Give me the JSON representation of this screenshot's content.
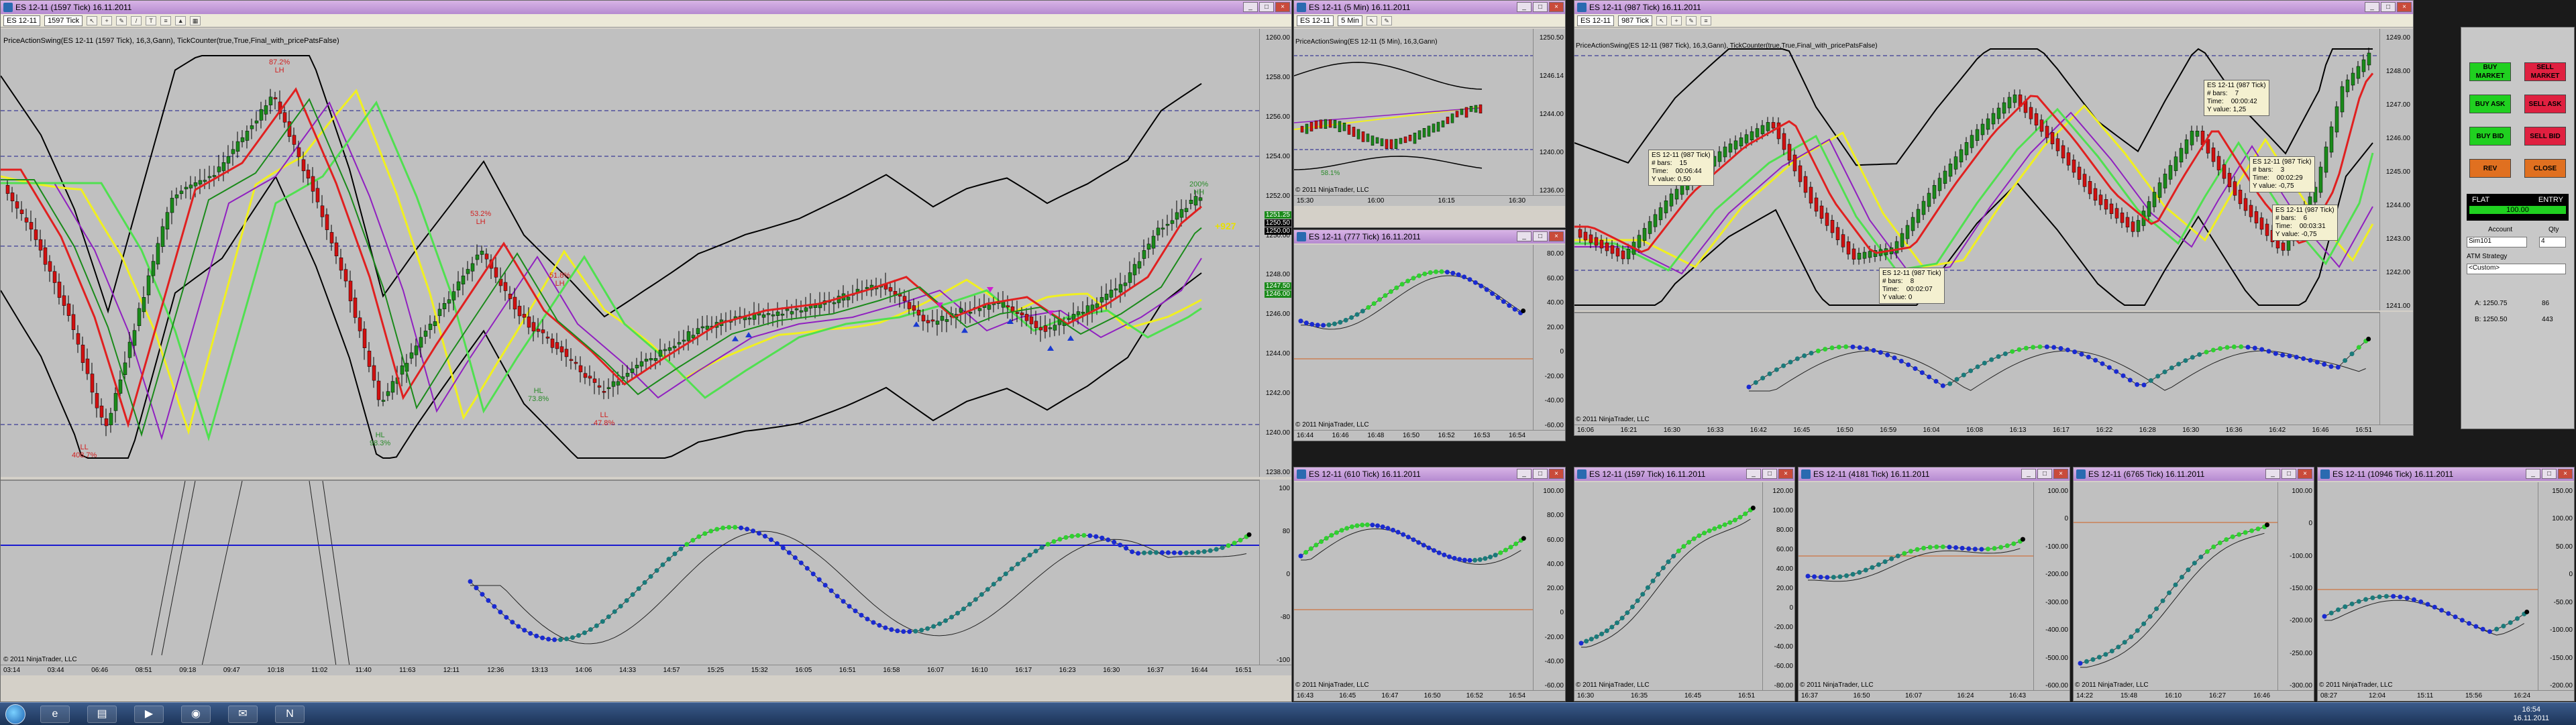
{
  "windows": {
    "main": {
      "title": "ES 12-11 (1597 Tick)  16.11.2011",
      "instrument": "ES 12-11",
      "interval": "1597 Tick",
      "indicator_label": "PriceActionSwing(ES 12-11 (1597 Tick), 16,3,Gann), TickCounter(true,True,Final_with_pricePatsFalse)",
      "copyright": "© 2011 NinjaTrader, LLC",
      "price_ticks": [
        "1260.00",
        "1258.00",
        "1256.00",
        "1254.00",
        "1252.00",
        "1250.00",
        "1248.00",
        "1246.00",
        "1244.00",
        "1242.00",
        "1240.00",
        "1238.00"
      ],
      "price_boxes": [
        "1251.25",
        "1250.50",
        "1250.00",
        "1247.50",
        "1246.00"
      ],
      "osc_ticks": [
        "100",
        "80",
        "0",
        "-80",
        "-100"
      ],
      "time_ticks": [
        "03:14",
        "03:44",
        "06:46",
        "08:51",
        "09:18",
        "09:47",
        "10:18",
        "11:02",
        "11:40",
        "11:63",
        "12:11",
        "12:36",
        "13:13",
        "14:06",
        "14:33",
        "14:57",
        "15:25",
        "15:32",
        "16:05",
        "16:51",
        "16:58",
        "16:07",
        "16:10",
        "16:17",
        "16:23",
        "16:30",
        "16:37",
        "16:44",
        "16:51"
      ],
      "annotations": [
        {
          "text": "87.2%\nLH",
          "color": "#d02020"
        },
        {
          "text": "LL\n408.7%",
          "color": "#d02020"
        },
        {
          "text": "HL\n98.3%",
          "color": "#2a8a2a"
        },
        {
          "text": "53.2%\nLH",
          "color": "#d02020"
        },
        {
          "text": "HL\n73.8%",
          "color": "#2a8a2a"
        },
        {
          "text": "51.8%\nLH",
          "color": "#d02020"
        },
        {
          "text": "LL\n47.8%",
          "color": "#d02020"
        },
        {
          "text": "200%\nHH",
          "color": "#2a8a2a"
        },
        {
          "text": "+927",
          "color": "#e8e000"
        }
      ]
    },
    "min5": {
      "title": "ES 12-11 (5 Min)  16.11.2011",
      "instrument": "ES 12-11",
      "interval": "5 Min",
      "indicator_label": "PriceActionSwing(ES 12-11 (5 Min), 16,3,Gann)",
      "copyright": "© 2011 NinjaTrader, LLC",
      "price_ticks": [
        "1250.50",
        "1246.14",
        "1244.00",
        "1240.00",
        "1236.00"
      ],
      "time_ticks": [
        "15:30",
        "16:00",
        "16:15",
        "16:30"
      ],
      "annotation": "58.1%"
    },
    "tick777": {
      "title": "ES 12-11 (777 Tick)  16.11.2011",
      "copyright": "© 2011 NinjaTrader, LLC",
      "ticks": [
        "80.00",
        "60.00",
        "40.00",
        "20.00",
        "0",
        "-20.00",
        "-40.00",
        "-60.00"
      ],
      "time_ticks": [
        "16:44",
        "16:46",
        "16:48",
        "16:50",
        "16:52",
        "16:53",
        "16:54"
      ]
    },
    "tick987": {
      "title": "ES 12-11 (987 Tick)  16.11.2011",
      "instrument": "ES 12-11",
      "interval": "987 Tick",
      "indicator_label": "PriceActionSwing(ES 12-11 (987 Tick), 16,3,Gann), TickCounter(true,True,Final_with_pricePatsFalse)",
      "copyright": "© 2011 NinjaTrader, LLC",
      "price_ticks": [
        "1249.00",
        "1248.00",
        "1247.00",
        "1246.00",
        "1245.00",
        "1244.00",
        "1243.00",
        "1242.00",
        "1241.00"
      ],
      "time_ticks": [
        "16:06",
        "16:21",
        "16:30",
        "16:33",
        "16:42",
        "16:45",
        "16:50",
        "16:59",
        "16:04",
        "16:08",
        "16:13",
        "16:17",
        "16:22",
        "16:28",
        "16:30",
        "16:36",
        "16:42",
        "16:46",
        "16:51"
      ],
      "tooltips": [
        "ES 12-11 (987 Tick)\n# bars:    15\nTime:    00:06:44\nY value: 0,50",
        "ES 12-11 (987 Tick)\n# bars:    7\nTime:    00:00:42\nY value: 1,25",
        "ES 12-11 (987 Tick)\n# bars:    8\nTime:    00:02:07\nY value: 0",
        "ES 12-11 (987 Tick)\n# bars:    3\nTime:    00:02:29\nY value: -0,75",
        "ES 12-11 (987 Tick)\n# bars:    6\nTime:    00:03:31\nY value: -0,75"
      ]
    },
    "tick610": {
      "title": "ES 12-11 (610 Tick)  16.11.2011",
      "copyright": "© 2011 NinjaTrader, LLC",
      "ticks": [
        "100.00",
        "80.00",
        "60.00",
        "40.00",
        "20.00",
        "0",
        "-20.00",
        "-40.00",
        "-60.00"
      ],
      "time_ticks": [
        "16:43",
        "16:45",
        "16:47",
        "16:50",
        "16:52",
        "16:54"
      ]
    },
    "tick1597b": {
      "title": "ES 12-11 (1597 Tick)  16.11.2011",
      "copyright": "© 2011 NinjaTrader, LLC",
      "ticks": [
        "120.00",
        "100.00",
        "80.00",
        "60.00",
        "40.00",
        "20.00",
        "0",
        "-20.00",
        "-40.00",
        "-60.00",
        "-80.00"
      ],
      "time_ticks": [
        "16:30",
        "16:35",
        "16:45",
        "16:51"
      ]
    },
    "tick4181": {
      "title": "ES 12-11 (4181 Tick)  16.11.2011",
      "copyright": "© 2011 NinjaTrader, LLC",
      "ticks": [
        "100.00",
        "0",
        "-100.00",
        "-200.00",
        "-300.00",
        "-400.00",
        "-500.00",
        "-600.00"
      ],
      "time_ticks": [
        "16:37",
        "16:50",
        "16:07",
        "16:24",
        "16:43"
      ]
    },
    "tick6765": {
      "title": "ES 12-11 (6765 Tick)  16.11.2011",
      "copyright": "© 2011 NinjaTrader, LLC",
      "ticks": [
        "100.00",
        "0",
        "-100.00",
        "-150.00",
        "-200.00",
        "-250.00",
        "-300.00"
      ],
      "time_ticks": [
        "14:22",
        "15:48",
        "16:10",
        "16:27",
        "16:46"
      ]
    },
    "tick10946": {
      "title": "ES 12-11 (10946 Tick)  16.11.2011",
      "copyright": "© 2011 NinjaTrader, LLC",
      "ticks": [
        "150.00",
        "100.00",
        "50.00",
        "0",
        "-50.00",
        "-100.00",
        "-150.00",
        "-200.00"
      ],
      "time_ticks": [
        "08:27",
        "12:04",
        "15:11",
        "15:56",
        "16:24"
      ]
    }
  },
  "trade_panel": {
    "buttons": [
      {
        "label": "BUY\nMARKET",
        "color": "#20d020"
      },
      {
        "label": "SELL\nMARKET",
        "color": "#e02040"
      },
      {
        "label": "BUY ASK",
        "color": "#20d020"
      },
      {
        "label": "SELL ASK",
        "color": "#e02040"
      },
      {
        "label": "BUY BID",
        "color": "#20d020"
      },
      {
        "label": "SELL BID",
        "color": "#e02040"
      },
      {
        "label": "REV",
        "color": "#e07020"
      },
      {
        "label": "CLOSE",
        "color": "#e07020"
      }
    ],
    "position": "FLAT",
    "entry": "ENTRY",
    "pnl": "100.00",
    "account_label": "Account",
    "qty_label": "Qty",
    "account_value": "Sim101",
    "qty_value": "4",
    "atm_label": "ATM Strategy",
    "atm_value": "<Custom>",
    "ask_label": "A: 1250.75",
    "ask_size": "86",
    "bid_label": "B: 1250.50",
    "bid_size": "443"
  },
  "taskbar": {
    "time": "16:54",
    "date": "16.11.2011"
  }
}
